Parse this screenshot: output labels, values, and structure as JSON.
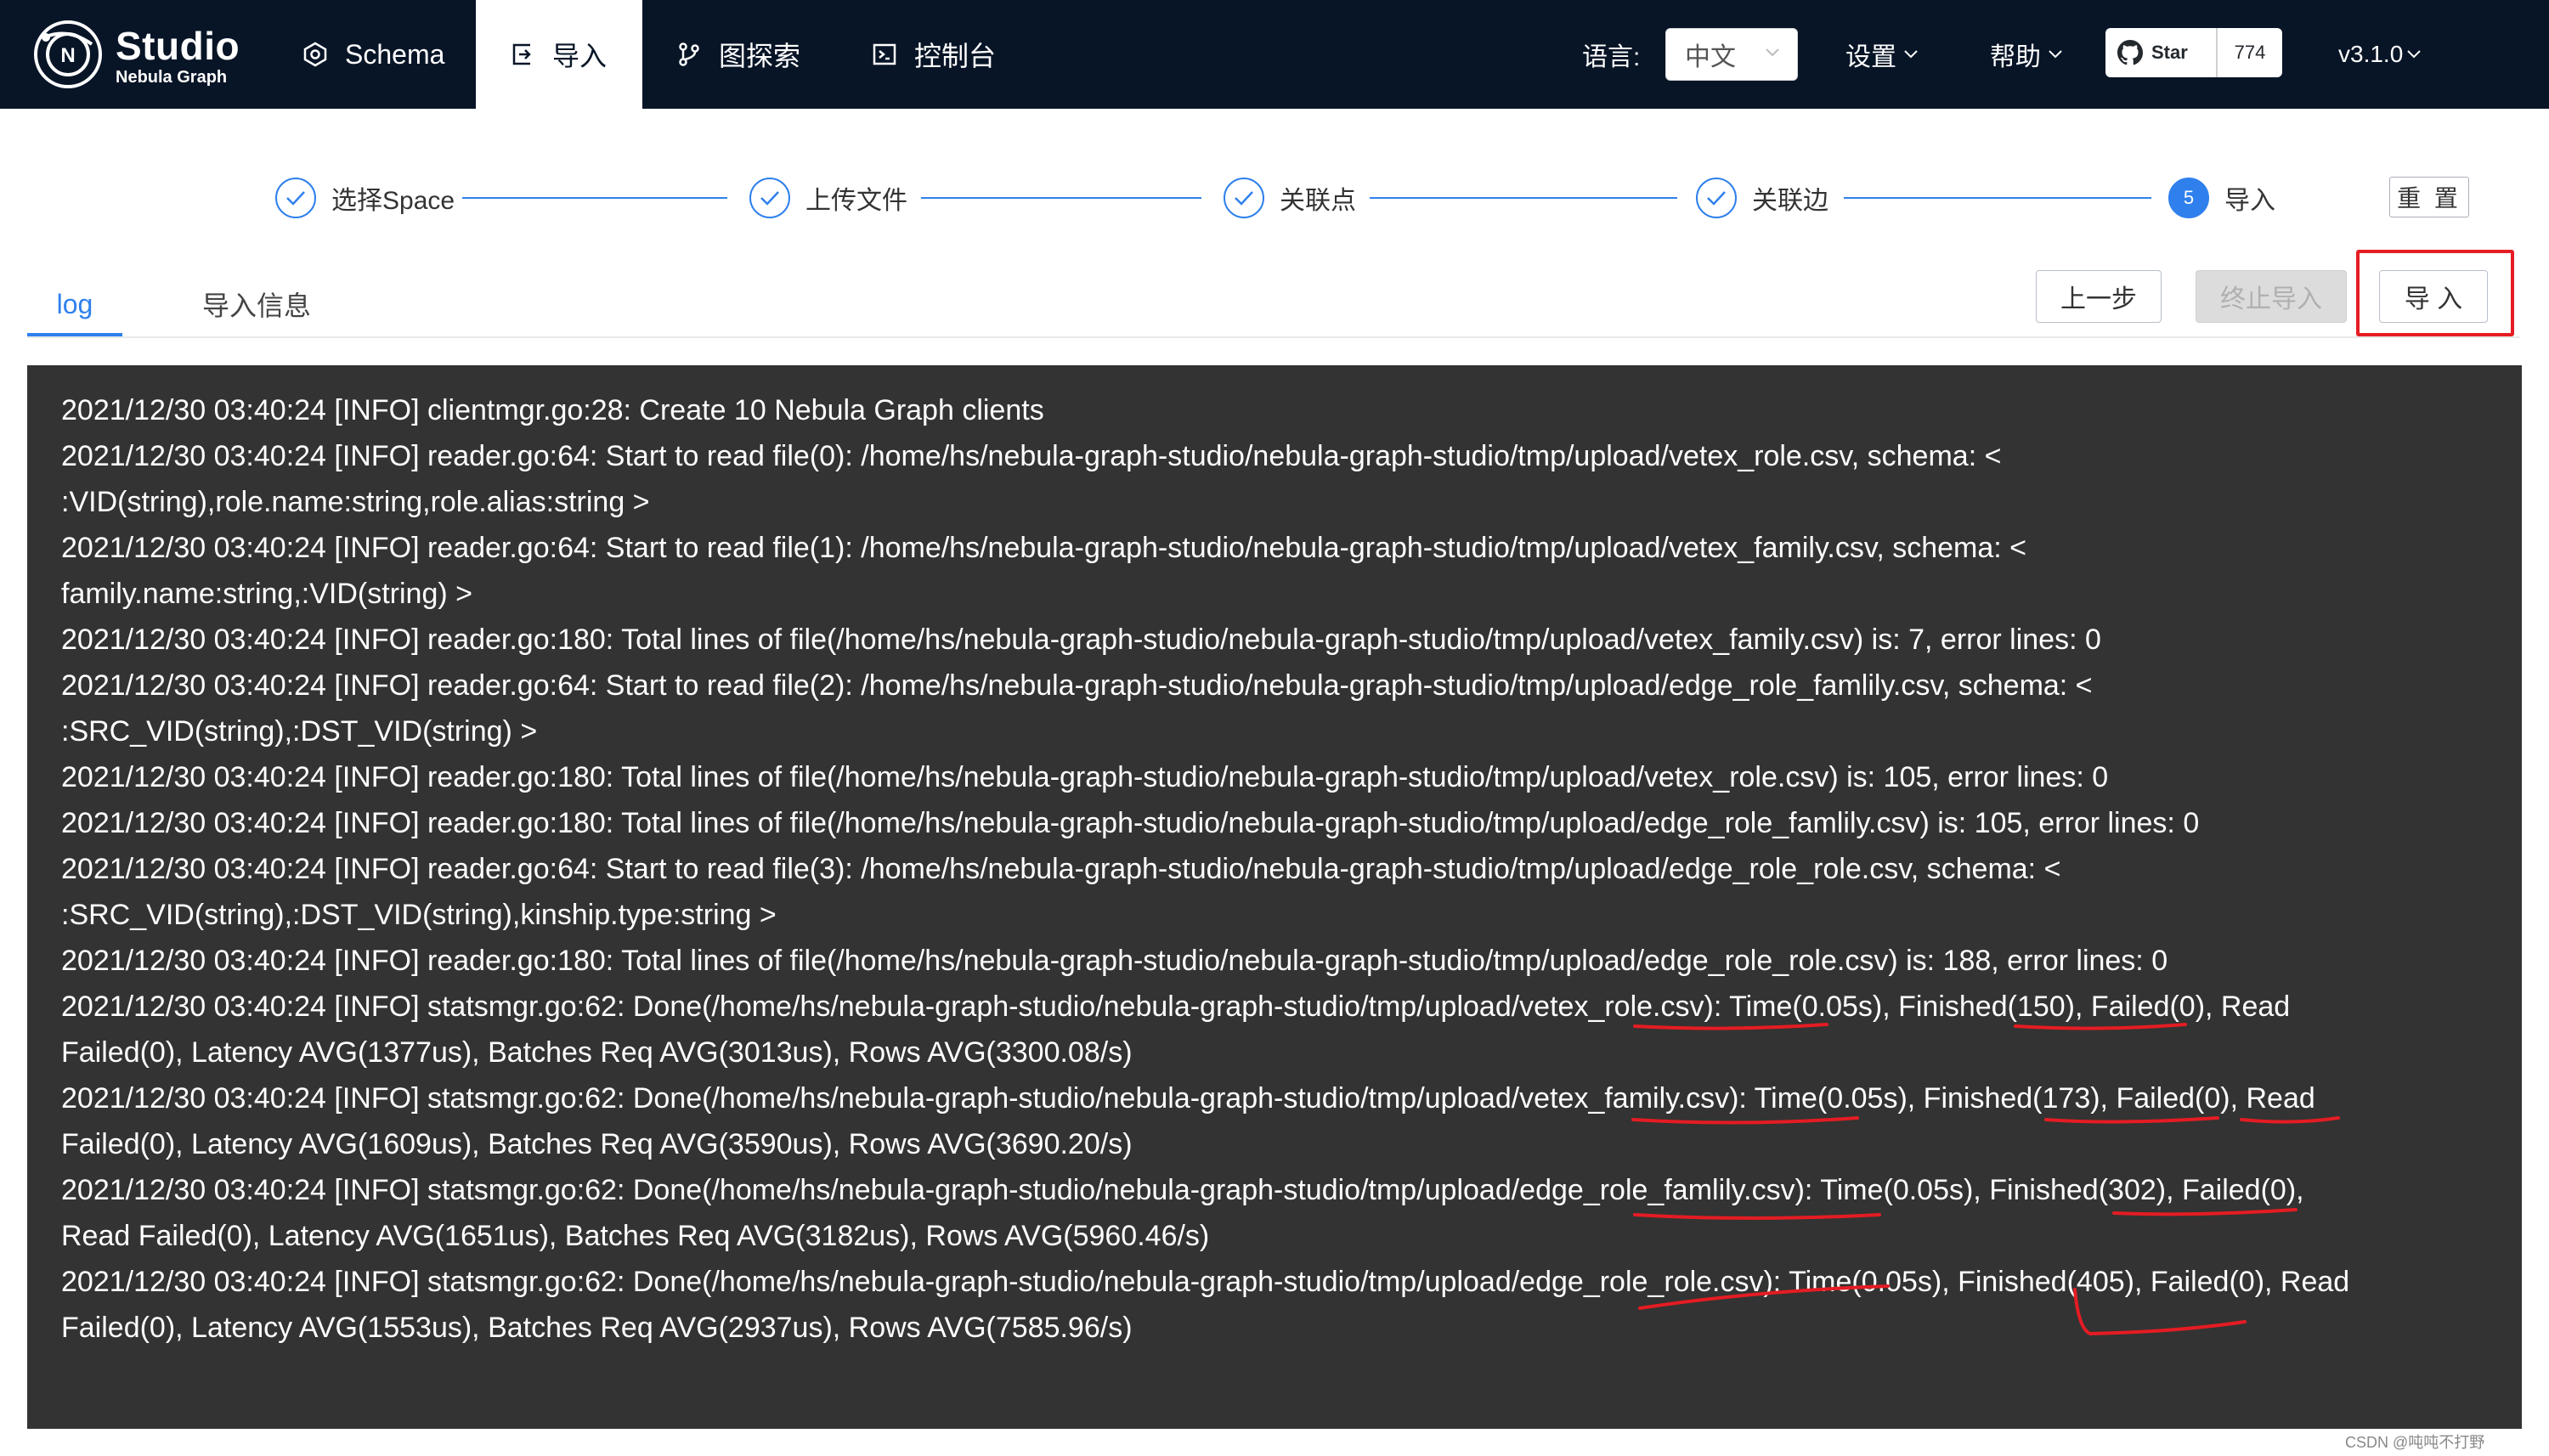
{
  "header": {
    "brand_title": "Studio",
    "brand_subtitle": "Nebula Graph",
    "nav": [
      {
        "label": "Schema",
        "icon": "schema-icon"
      },
      {
        "label": "导入",
        "icon": "import-icon",
        "active": true
      },
      {
        "label": "图探索",
        "icon": "branch-icon"
      },
      {
        "label": "控制台",
        "icon": "terminal-icon"
      }
    ],
    "language_label": "语言:",
    "language_value": "中文",
    "settings_label": "设置",
    "help_label": "帮助",
    "github_star_label": "Star",
    "github_star_count": "774",
    "version": "v3.1.0"
  },
  "steps": [
    {
      "label": "选择Space",
      "state": "done"
    },
    {
      "label": "上传文件",
      "state": "done"
    },
    {
      "label": "关联点",
      "state": "done"
    },
    {
      "label": "关联边",
      "state": "done"
    },
    {
      "label": "导入",
      "state": "current",
      "number": "5"
    }
  ],
  "reset_label": "重 置",
  "tabs": {
    "log": "log",
    "info": "导入信息"
  },
  "buttons": {
    "prev": "上一步",
    "stop": "终止导入",
    "import": "导 入"
  },
  "log_lines": [
    "2021/12/30 03:40:24 [INFO] clientmgr.go:28: Create 10 Nebula Graph clients",
    "2021/12/30 03:40:24 [INFO] reader.go:64: Start to read file(0): /home/hs/nebula-graph-studio/nebula-graph-studio/tmp/upload/vetex_role.csv, schema: <",
    ":VID(string),role.name:string,role.alias:string >",
    "2021/12/30 03:40:24 [INFO] reader.go:64: Start to read file(1): /home/hs/nebula-graph-studio/nebula-graph-studio/tmp/upload/vetex_family.csv, schema: <",
    "family.name:string,:VID(string) >",
    "2021/12/30 03:40:24 [INFO] reader.go:180: Total lines of file(/home/hs/nebula-graph-studio/nebula-graph-studio/tmp/upload/vetex_family.csv) is: 7, error lines: 0",
    "2021/12/30 03:40:24 [INFO] reader.go:64: Start to read file(2): /home/hs/nebula-graph-studio/nebula-graph-studio/tmp/upload/edge_role_famlily.csv, schema: <",
    ":SRC_VID(string),:DST_VID(string) >",
    "2021/12/30 03:40:24 [INFO] reader.go:180: Total lines of file(/home/hs/nebula-graph-studio/nebula-graph-studio/tmp/upload/vetex_role.csv) is: 105, error lines: 0",
    "2021/12/30 03:40:24 [INFO] reader.go:180: Total lines of file(/home/hs/nebula-graph-studio/nebula-graph-studio/tmp/upload/edge_role_famlily.csv) is: 105, error lines: 0",
    "2021/12/30 03:40:24 [INFO] reader.go:64: Start to read file(3): /home/hs/nebula-graph-studio/nebula-graph-studio/tmp/upload/edge_role_role.csv, schema: <",
    ":SRC_VID(string),:DST_VID(string),kinship.type:string >",
    "2021/12/30 03:40:24 [INFO] reader.go:180: Total lines of file(/home/hs/nebula-graph-studio/nebula-graph-studio/tmp/upload/edge_role_role.csv) is: 188, error lines: 0",
    "2021/12/30 03:40:24 [INFO] statsmgr.go:62: Done(/home/hs/nebula-graph-studio/nebula-graph-studio/tmp/upload/vetex_role.csv): Time(0.05s), Finished(150), Failed(0), Read",
    "Failed(0), Latency AVG(1377us), Batches Req AVG(3013us), Rows AVG(3300.08/s)",
    "2021/12/30 03:40:24 [INFO] statsmgr.go:62: Done(/home/hs/nebula-graph-studio/nebula-graph-studio/tmp/upload/vetex_family.csv): Time(0.05s), Finished(173), Failed(0), Read",
    "Failed(0), Latency AVG(1609us), Batches Req AVG(3590us), Rows AVG(3690.20/s)",
    "2021/12/30 03:40:24 [INFO] statsmgr.go:62: Done(/home/hs/nebula-graph-studio/nebula-graph-studio/tmp/upload/edge_role_famlily.csv): Time(0.05s), Finished(302), Failed(0),",
    "Read Failed(0), Latency AVG(1651us), Batches Req AVG(3182us), Rows AVG(5960.46/s)",
    "2021/12/30 03:40:24 [INFO] statsmgr.go:62: Done(/home/hs/nebula-graph-studio/nebula-graph-studio/tmp/upload/edge_role_role.csv): Time(0.05s), Finished(405), Failed(0), Read",
    "Failed(0), Latency AVG(1553us), Batches Req AVG(2937us), Rows AVG(7585.96/s)"
  ],
  "watermark": "CSDN @吨吨不打野",
  "colors": {
    "header_bg": "#081527",
    "accent": "#2f80ed",
    "log_bg": "#333333",
    "annotation": "#e51c23"
  }
}
